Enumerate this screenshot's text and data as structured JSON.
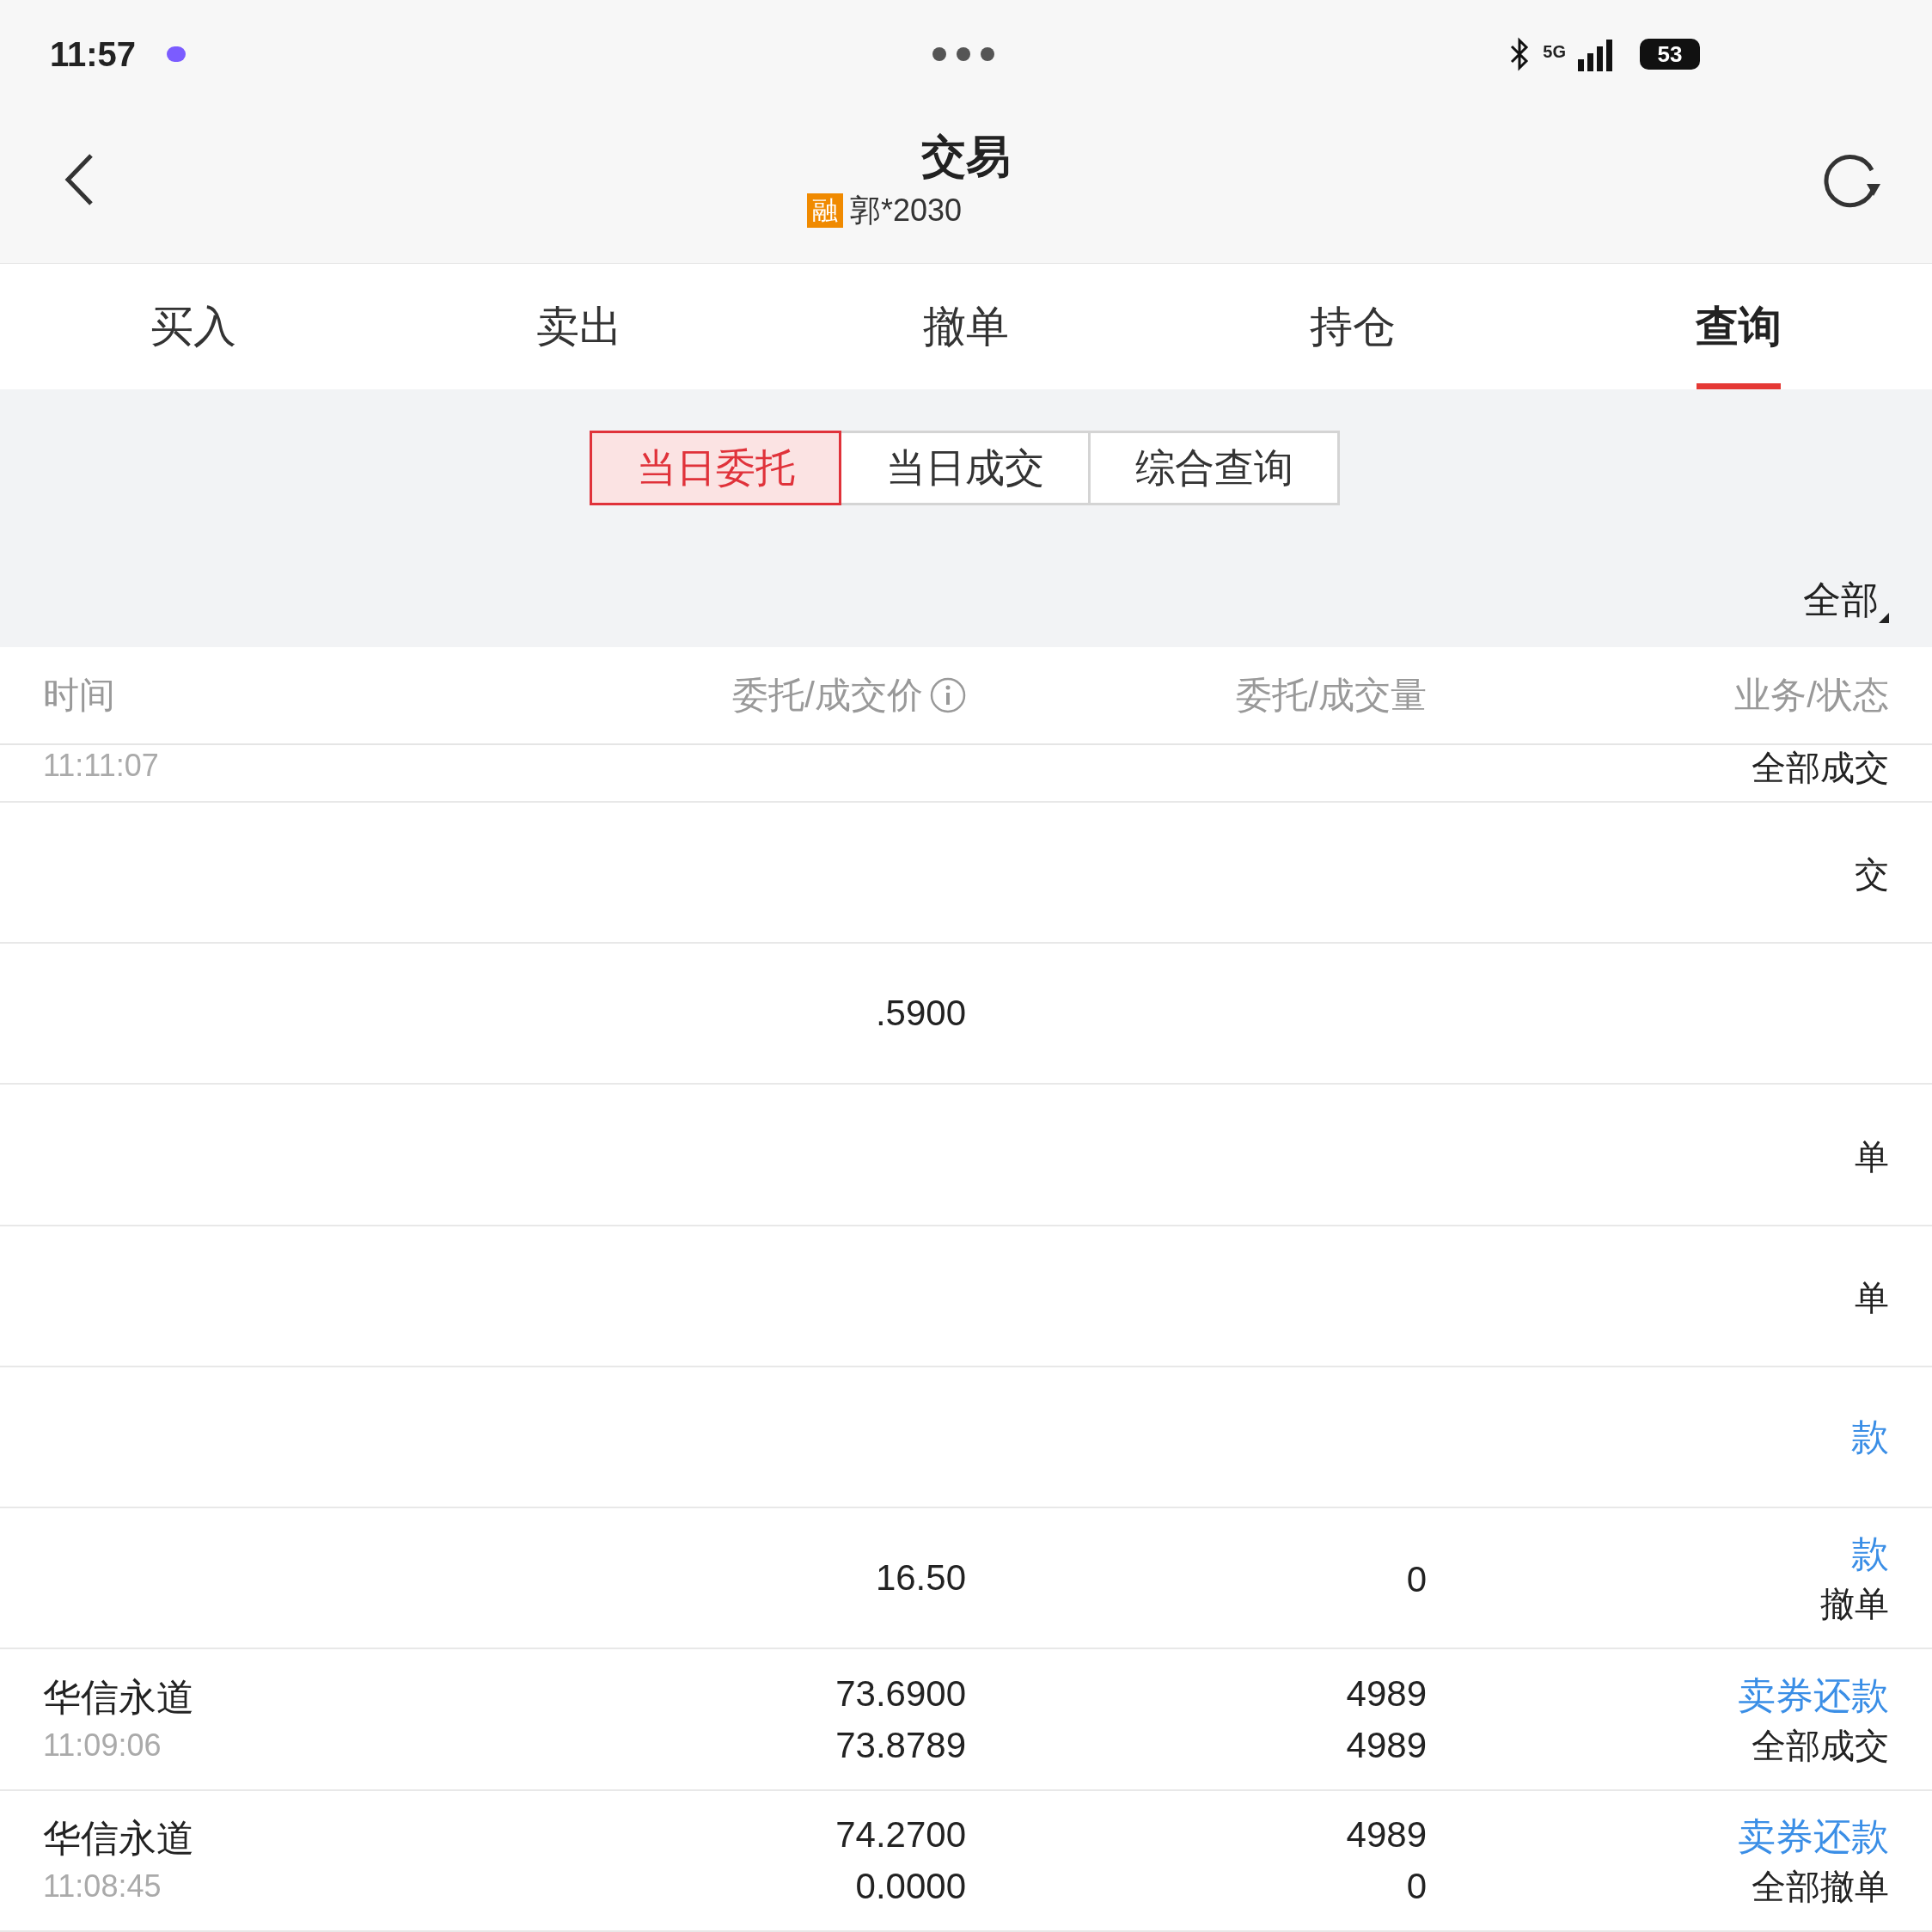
{
  "status_bar": {
    "time": "11:57",
    "network": "5G",
    "battery": "53"
  },
  "nav": {
    "title": "交易",
    "badge": "融",
    "account": "郭*2030"
  },
  "tabs": [
    {
      "label": "买入",
      "selected": false
    },
    {
      "label": "卖出",
      "selected": false
    },
    {
      "label": "撤单",
      "selected": false
    },
    {
      "label": "持仓",
      "selected": false
    },
    {
      "label": "查询",
      "selected": true
    }
  ],
  "segments": [
    {
      "label": "当日委托",
      "selected": true
    },
    {
      "label": "当日成交",
      "selected": false
    },
    {
      "label": "综合查询",
      "selected": false
    }
  ],
  "filter": {
    "label": "全部"
  },
  "table": {
    "columns": [
      "时间",
      "委托/成交价",
      "委托/成交量",
      "业务/状态"
    ],
    "rows": [
      {
        "kind": "cut",
        "time": "11:11:07",
        "status": "全部成交"
      },
      {
        "kind": "row",
        "status": "交"
      },
      {
        "kind": "row",
        "price": ".5900"
      },
      {
        "kind": "row",
        "status": "单"
      },
      {
        "kind": "row",
        "status": "单"
      },
      {
        "kind": "row",
        "business": "款"
      },
      {
        "kind": "row",
        "price": "16.50",
        "business": "款",
        "qty2": "0",
        "status": "撤单"
      },
      {
        "kind": "row",
        "name": "华信永道",
        "time": "11:09:06",
        "price": "73.6900",
        "price2": "73.8789",
        "qty": "4989",
        "qty2": "4989",
        "business": "卖券还款",
        "status": "全部成交"
      },
      {
        "kind": "row",
        "name": "华信永道",
        "time": "11:08:45",
        "price": "74.2700",
        "price2": "0.0000",
        "qty": "4989",
        "qty2": "0",
        "business": "卖券还款",
        "status": "全部撤单"
      }
    ]
  }
}
